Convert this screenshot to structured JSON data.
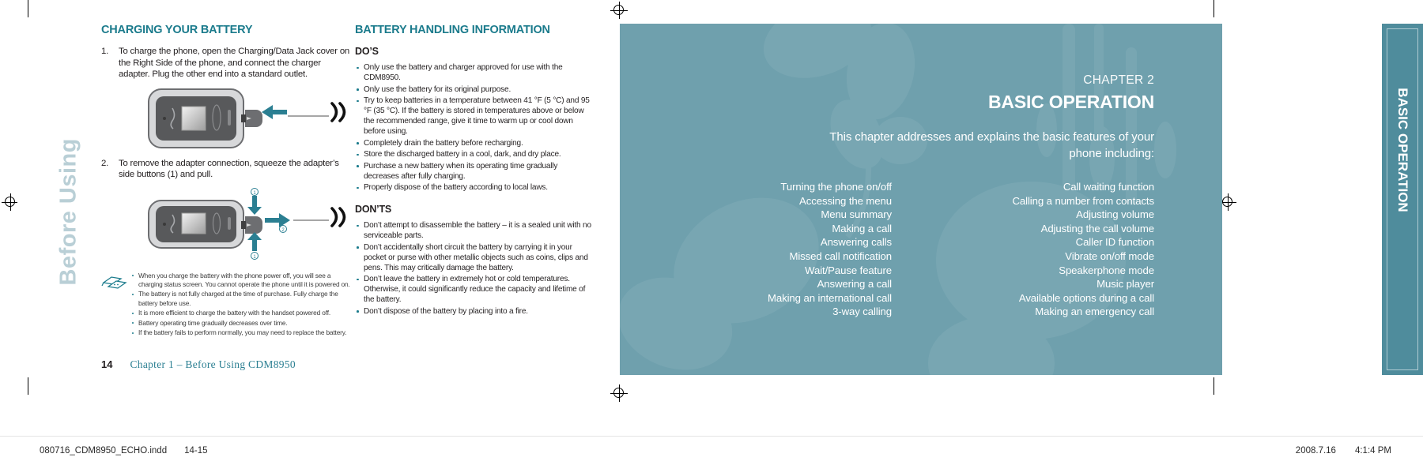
{
  "left_page": {
    "vertical_tab_text": "Before Using",
    "column_a": {
      "heading": "CHARGING YOUR BATTERY",
      "steps": [
        {
          "num": "1.",
          "text": "To charge the phone, open the Charging/Data Jack cover on the Right Side of the phone, and connect the charger adapter. Plug the other end into a standard outlet."
        },
        {
          "num": "2.",
          "text": "To remove the adapter connection, squeeze the adapter’s side buttons (1) and pull."
        }
      ],
      "figure1_name": "phone-with-charger-adapter-illustration",
      "figure2_name": "phone-adapter-removal-illustration",
      "note_icon_name": "note-cards-icon",
      "notes": [
        "When you charge the battery with the phone power off, you will see a charging status screen. You cannot operate the phone until it is powered on.",
        "The battery is not fully charged at the time of purchase. Fully charge the battery before use.",
        "It is more efficient to charge the battery with the handset powered off.",
        "Battery operating time gradually decreases over time.",
        "If the battery fails to perform normally, you may need to replace the battery."
      ]
    },
    "column_b": {
      "heading": "BATTERY HANDLING INFORMATION",
      "dos_heading": "DO’S",
      "dos": [
        "Only use the battery and charger approved for use with the CDM8950.",
        "Only use the battery for its original purpose.",
        "Try to keep batteries in a temperature between 41 °F (5 °C) and 95 °F (35 °C). If the battery is stored in temperatures above or below the recommended range, give it time to warm up or cool down before using.",
        "Completely drain the battery before recharging.",
        "Store the discharged battery in a cool, dark, and dry place.",
        "Purchase a new battery when its operating time gradually decreases after fully charging.",
        "Properly dispose of the battery according to local laws."
      ],
      "donts_heading": "DON’TS",
      "donts": [
        "Don’t attempt to disassemble the battery – it is a sealed unit with no serviceable parts.",
        "Don’t accidentally short circuit the battery by carrying it in your pocket or purse with other metallic objects such as coins, clips and pens. This may critically damage the battery.",
        "Don’t leave the battery in extremely hot or cold temperatures. Otherwise, it could significantly reduce the capacity and lifetime of the battery.",
        "Don’t dispose of the battery by placing into a fire."
      ]
    },
    "footer": {
      "page_number": "14",
      "running_head": "Chapter 1 – Before Using CDM8950"
    }
  },
  "right_page": {
    "chapter_label": "CHAPTER 2",
    "chapter_title": "BASIC OPERATION",
    "intro": "This chapter addresses and explains the basic features of your phone including:",
    "features_left": [
      "Turning the phone on/off",
      "Accessing the menu",
      "Menu summary",
      "Making a call",
      "Answering calls",
      "Missed call notification",
      "Wait/Pause feature",
      "Answering a call",
      "Making an international call",
      "3-way calling"
    ],
    "features_right": [
      "Call waiting function",
      "Calling a number from contacts",
      "Adjusting volume",
      "Adjusting the call volume",
      "Caller ID function",
      "Vibrate on/off mode",
      "Speakerphone mode",
      "Music player",
      "Available options during a call",
      "Making an emergency call"
    ],
    "side_tab_text": "BASIC OPERATION"
  },
  "status_bar": {
    "file_name": "080716_CDM8950_ECHO.indd",
    "page_range": "14-15",
    "date": "2008.7.16",
    "time": "4:1:4 PM"
  },
  "colors": {
    "teal_heading": "#1b7b8c",
    "page_teal": "#6fa0ad",
    "tab_teal": "#4f8c9c",
    "runhead_teal": "#2b7f92",
    "arrow_teal": "#2b7f92"
  }
}
